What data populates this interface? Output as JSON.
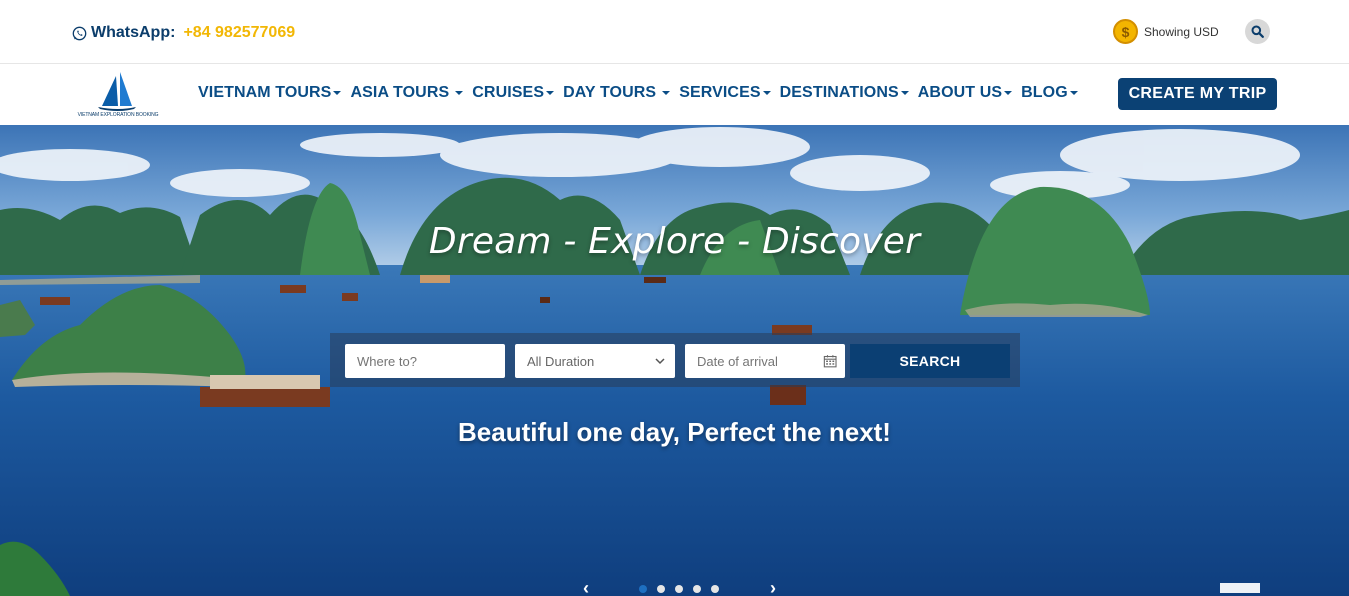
{
  "topbar": {
    "whatsapp_label": "WhatsApp:",
    "whatsapp_number": "+84 982577069",
    "currency_symbol": "$",
    "currency_label": "Showing USD"
  },
  "logo": {
    "text": "VIETNAM EXPLORATION BOOKING"
  },
  "nav": {
    "items": [
      {
        "label": "VIETNAM TOURS"
      },
      {
        "label": "ASIA TOURS"
      },
      {
        "label": "CRUISES"
      },
      {
        "label": "DAY TOURS"
      },
      {
        "label": "SERVICES"
      },
      {
        "label": "DESTINATIONS"
      },
      {
        "label": "ABOUT US"
      },
      {
        "label": "BLOG"
      }
    ],
    "cta_label": "CREATE MY TRIP"
  },
  "hero": {
    "title": "Dream - Explore - Discover",
    "subtitle": "Beautiful one day, Perfect the next!",
    "search": {
      "where_placeholder": "Where to?",
      "duration_value": "All Duration",
      "date_placeholder": "Date of arrival",
      "submit_label": "SEARCH"
    },
    "slider": {
      "slide_count": 5,
      "active_index": 0
    }
  },
  "colors": {
    "brand_navy": "#0b4174",
    "nav_text": "#0b4d86",
    "accent_yellow": "#f2b705"
  },
  "icons": [
    "whatsapp-icon",
    "coin-icon",
    "search-icon",
    "chevron-down-icon",
    "calendar-icon",
    "chevron-left-icon",
    "chevron-right-icon"
  ]
}
